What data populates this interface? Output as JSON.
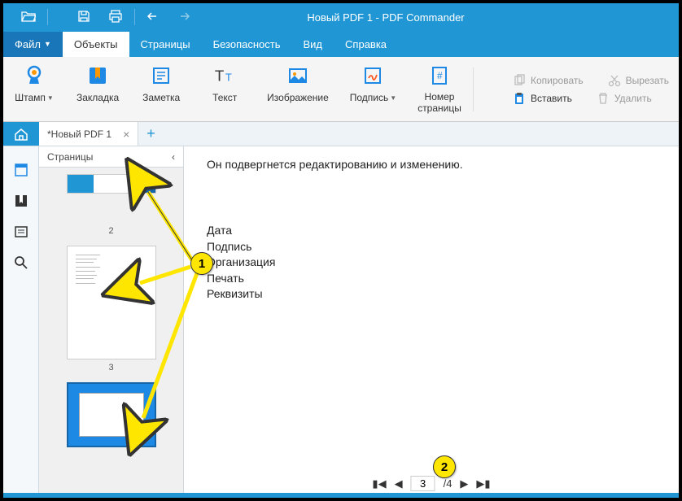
{
  "titlebar": {
    "title": "Новый PDF 1 - PDF Commander"
  },
  "menu": {
    "file": "Файл",
    "objects": "Объекты",
    "pages": "Страницы",
    "security": "Безопасность",
    "view": "Вид",
    "help": "Справка"
  },
  "ribbon": {
    "stamp": "Штамп",
    "bookmark": "Закладка",
    "note": "Заметка",
    "text": "Текст",
    "image": "Изображение",
    "signature": "Подпись",
    "pagenum": "Номер\nстраницы",
    "copy": "Копировать",
    "paste": "Вставить",
    "cut": "Вырезать",
    "delete": "Удалить"
  },
  "tabs": {
    "doc": "*Новый PDF 1"
  },
  "pages_panel": {
    "title": "Страницы",
    "p2": "2",
    "p3": "3"
  },
  "document": {
    "line1": "Он подвергнется редактированию и изменению.",
    "block": "Дата\nПодпись\nОрганизация\nПечать\nРеквизиты"
  },
  "pager": {
    "current": "3",
    "total": "/4"
  },
  "callouts": {
    "c1": "1",
    "c2": "2"
  }
}
